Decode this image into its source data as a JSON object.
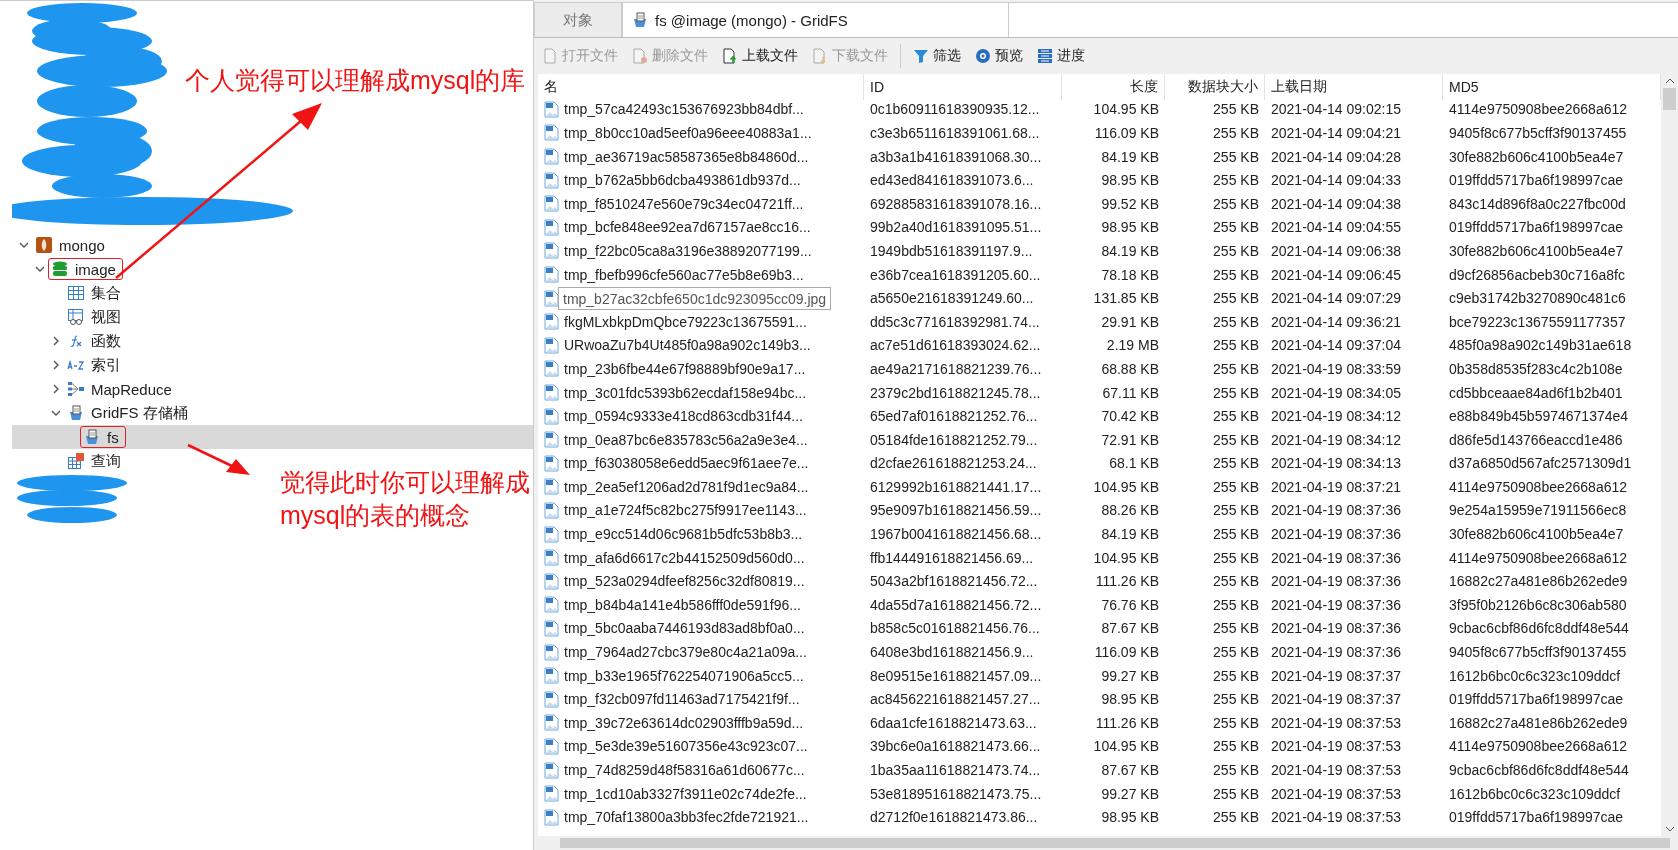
{
  "tree": [
    {
      "label": "mongo",
      "kind": "connection",
      "expanded": true,
      "selected": false,
      "highlighted": false,
      "children": [
        {
          "label": "image",
          "kind": "database",
          "expanded": true,
          "selected": false,
          "highlighted": true,
          "children": [
            {
              "label": "集合",
              "kind": "collections",
              "selected": false,
              "highlighted": false
            },
            {
              "label": "视图",
              "kind": "views",
              "selected": false,
              "highlighted": false
            },
            {
              "label": "函数",
              "kind": "functions",
              "expanded": false,
              "selected": false,
              "highlighted": false
            },
            {
              "label": "索引",
              "kind": "indexes",
              "expanded": false,
              "selected": false,
              "highlighted": false
            },
            {
              "label": "MapReduce",
              "kind": "mapreduce",
              "expanded": false,
              "selected": false,
              "highlighted": false
            },
            {
              "label": "GridFS 存储桶",
              "kind": "gridfs",
              "expanded": true,
              "selected": false,
              "highlighted": false,
              "children": [
                {
                  "label": "fs",
                  "kind": "bucket",
                  "selected": true,
                  "highlighted": true
                }
              ]
            },
            {
              "label": "查询",
              "kind": "queries",
              "selected": false,
              "highlighted": false
            }
          ]
        }
      ]
    }
  ],
  "annotations": [
    {
      "lines": [
        "个人觉得可以理解成mysql的库"
      ]
    },
    {
      "lines": [
        "觉得此时你可以理解成",
        "mysql的表的概念"
      ]
    }
  ],
  "tabs": [
    {
      "label": "对象",
      "selected": false
    },
    {
      "label": "fs @image (mongo) - GridFS",
      "selected": true
    }
  ],
  "toolbar": [
    {
      "label": "打开文件",
      "kind": "open",
      "disabled": true
    },
    {
      "label": "删除文件",
      "kind": "delete",
      "disabled": true
    },
    {
      "label": "上载文件",
      "kind": "upload",
      "disabled": false
    },
    {
      "label": "下载文件",
      "kind": "download",
      "disabled": true
    },
    {
      "label": "筛选",
      "kind": "filter",
      "disabled": false
    },
    {
      "label": "预览",
      "kind": "preview",
      "disabled": false
    },
    {
      "label": "进度",
      "kind": "progress",
      "disabled": false
    }
  ],
  "table": {
    "columns": [
      "名",
      "ID",
      "长度",
      "数据块大小",
      "上载日期",
      "MD5"
    ],
    "rows": [
      [
        "tmp_57ca42493c153676923bb84dbf...",
        "0c1b60911618390935.12...",
        "104.95 KB",
        "255 KB",
        "2021-04-14 09:02:15",
        "4114e9750908bee2668a612"
      ],
      [
        "tmp_8b0cc10ad5eef0a96eee40883a1...",
        "c3e3b6511618391061.68...",
        "116.09 KB",
        "255 KB",
        "2021-04-14 09:04:21",
        "9405f8c677b5cff3f90137455"
      ],
      [
        "tmp_ae36719ac58587365e8b84860d...",
        "a3b3a1b41618391068.30...",
        "84.19 KB",
        "255 KB",
        "2021-04-14 09:04:28",
        "30fe882b606c4100b5ea4e7"
      ],
      [
        "tmp_b762a5bb6dcba493861db937d...",
        "ed43ed841618391073.6...",
        "98.95 KB",
        "255 KB",
        "2021-04-14 09:04:33",
        "019ffdd5717ba6f198997cae"
      ],
      [
        "tmp_f8510247e560e79c34ec04721ff...",
        "692885831618391078.16...",
        "99.52 KB",
        "255 KB",
        "2021-04-14 09:04:38",
        "843c14d896f8a0c227fbc00d"
      ],
      [
        "tmp_bcfe848ee92ea7d67157ae8cc16...",
        "99b2a40d1618391095.51...",
        "98.95 KB",
        "255 KB",
        "2021-04-14 09:04:55",
        "019ffdd5717ba6f198997cae"
      ],
      [
        "tmp_f22bc05ca8a3196e38892077199...",
        "1949bdb51618391197.9...",
        "84.19 KB",
        "255 KB",
        "2021-04-14 09:06:38",
        "30fe882b606c4100b5ea4e7"
      ],
      [
        "tmp_fbefb996cfe560ac77e5b8e69b3...",
        "e36b7cea1618391205.60...",
        "78.18 KB",
        "255 KB",
        "2021-04-14 09:06:45",
        "d9cf26856acbeb30c716a8fc"
      ],
      [
        {
          "text": "tmp_b27ac32cbfe650c1dc923095cc09.jpg",
          "kind": "tooltip"
        },
        "a5650e21618391249.60...",
        "131.85 KB",
        "255 KB",
        "2021-04-14 09:07:29",
        "c9eb31742b3270890c481c6"
      ],
      [
        "fkgMLxbkpDmQbce79223c13675591...",
        "dd5c3c771618392981.74...",
        "29.91 KB",
        "255 KB",
        "2021-04-14 09:36:21",
        "bce79223c13675591177357"
      ],
      [
        "URwoaZu7b4Ut485f0a98a902c149b3...",
        "ac7e51d61618393024.62...",
        "2.19 MB",
        "255 KB",
        "2021-04-14 09:37:04",
        "485f0a98a902c149b31ae618"
      ],
      [
        "tmp_23b6fbe44e67f98889bf90e9a17...",
        "ae49a2171618821239.76...",
        "68.88 KB",
        "255 KB",
        "2021-04-19 08:33:59",
        "0b358d8535f283c4c2b108e"
      ],
      [
        "tmp_3c01fdc5393b62ecdaf158e94bc...",
        "2379c2bd1618821245.78...",
        "67.11 KB",
        "255 KB",
        "2021-04-19 08:34:05",
        "cd5bbceaae84ad6f1b2b401"
      ],
      [
        "tmp_0594c9333e418cd863cdb31f44...",
        "65ed7af01618821252.76...",
        "70.42 KB",
        "255 KB",
        "2021-04-19 08:34:12",
        "e88b849b45b5974671374e4"
      ],
      [
        "tmp_0ea87bc6e835783c56a2a9e3e4...",
        "05184fde1618821252.79...",
        "72.91 KB",
        "255 KB",
        "2021-04-19 08:34:12",
        "d86fe5d143766eaccd1e486"
      ],
      [
        "tmp_f63038058e6edd5aec9f61aee7e...",
        "d2cfae261618821253.24...",
        "68.1 KB",
        "255 KB",
        "2021-04-19 08:34:13",
        "d37a6850d567afc2571309d1"
      ],
      [
        "tmp_2ea5ef1206ad2d781f9d1ec9a84...",
        "6129992b1618821441.17...",
        "104.95 KB",
        "255 KB",
        "2021-04-19 08:37:21",
        "4114e9750908bee2668a612"
      ],
      [
        "tmp_a1e724f5c82bc275f9917ee1143...",
        "95e9097b1618821456.59...",
        "88.26 KB",
        "255 KB",
        "2021-04-19 08:37:36",
        "9e254a15959e71911566ec8"
      ],
      [
        "tmp_e9cc514d06c9681b5dfc53b8b3...",
        "1967b0041618821456.68...",
        "84.19 KB",
        "255 KB",
        "2021-04-19 08:37:36",
        "30fe882b606c4100b5ea4e7"
      ],
      [
        "tmp_afa6d6617c2b44152509d560d0...",
        "ffb144491618821456.69...",
        "104.95 KB",
        "255 KB",
        "2021-04-19 08:37:36",
        "4114e9750908bee2668a612"
      ],
      [
        "tmp_523a0294dfeef8256c32df80819...",
        "5043a2bf1618821456.72...",
        "111.26 KB",
        "255 KB",
        "2021-04-19 08:37:36",
        "16882c27a481e86b262ede9"
      ],
      [
        "tmp_b84b4a141e4b586fff0de591f96...",
        "4da55d7a1618821456.72...",
        "76.76 KB",
        "255 KB",
        "2021-04-19 08:37:36",
        "3f95f0b2126b6c8c306ab580"
      ],
      [
        "tmp_5bc0aaba7446193d83ad8bf0a0...",
        "b858c5c01618821456.76...",
        "87.67 KB",
        "255 KB",
        "2021-04-19 08:37:36",
        "9cbac6cbf86d6fc8ddf48e544"
      ],
      [
        "tmp_7964ad27cbc379e80c4a21a09a...",
        "6408e3bd1618821456.9...",
        "116.09 KB",
        "255 KB",
        "2021-04-19 08:37:36",
        "9405f8c677b5cff3f90137455"
      ],
      [
        "tmp_b33e1965f762254071906a5cc5...",
        "8e09515e1618821457.09...",
        "99.27 KB",
        "255 KB",
        "2021-04-19 08:37:37",
        "1612b6bc0c6c323c109ddcf"
      ],
      [
        "tmp_f32cb097fd11463ad7175421f9f...",
        "ac8456221618821457.27...",
        "98.95 KB",
        "255 KB",
        "2021-04-19 08:37:37",
        "019ffdd5717ba6f198997cae"
      ],
      [
        "tmp_39c72e63614dc02903fffb9a59d...",
        "6daa1cfe1618821473.63...",
        "111.26 KB",
        "255 KB",
        "2021-04-19 08:37:53",
        "16882c27a481e86b262ede9"
      ],
      [
        "tmp_5e3de39e51607356e43c923c07...",
        "39bc6e0a1618821473.66...",
        "104.95 KB",
        "255 KB",
        "2021-04-19 08:37:53",
        "4114e9750908bee2668a612"
      ],
      [
        "tmp_74d8259d48f58316a61d60677c...",
        "1ba35aa11618821473.74...",
        "87.67 KB",
        "255 KB",
        "2021-04-19 08:37:53",
        "9cbac6cbf86d6fc8ddf48e544"
      ],
      [
        "tmp_1cd10ab3327f3911e02c74de2fe...",
        "53e818951618821473.75...",
        "99.27 KB",
        "255 KB",
        "2021-04-19 08:37:53",
        "1612b6bc0c6c323c109ddcf"
      ],
      [
        "tmp_70faf13800a3bb3fec2fde721921...",
        "d2712f0e1618821473.86...",
        "98.95 KB",
        "255 KB",
        "2021-04-19 08:37:53",
        "019ffdd5717ba6f198997cae"
      ]
    ]
  }
}
